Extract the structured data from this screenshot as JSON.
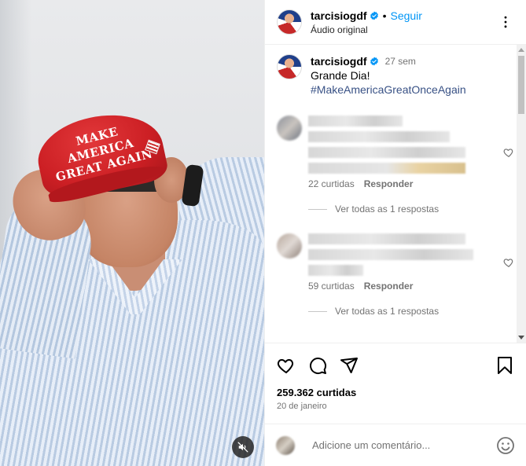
{
  "header": {
    "username": "tarcisiogdf",
    "separator": "•",
    "follow_label": "Seguir",
    "audio_label": "Áudio original"
  },
  "media": {
    "cap_text_line1": "MAKE AMERICA",
    "cap_text_line2": "GREAT AGAIN",
    "mute_icon": "speaker-muted-icon"
  },
  "caption": {
    "username": "tarcisiogdf",
    "time": "27 sem",
    "text": "Grande Dia!",
    "hashtag": "#MakeAmericaGreatOnceAgain"
  },
  "comments": [
    {
      "likes": "22 curtidas",
      "reply_label": "Responder",
      "view_replies": "Ver todas as 1 respostas"
    },
    {
      "likes": "59 curtidas",
      "reply_label": "Responder",
      "view_replies": "Ver todas as 1 respostas"
    }
  ],
  "stats": {
    "likes": "259.362 curtidas",
    "date": "20 de janeiro"
  },
  "composer": {
    "placeholder": "Adicione um comentário..."
  },
  "colors": {
    "link_blue": "#0095f6",
    "hashtag_blue": "#385185",
    "muted_text": "#737373",
    "cap_red": "#cc1f24"
  }
}
